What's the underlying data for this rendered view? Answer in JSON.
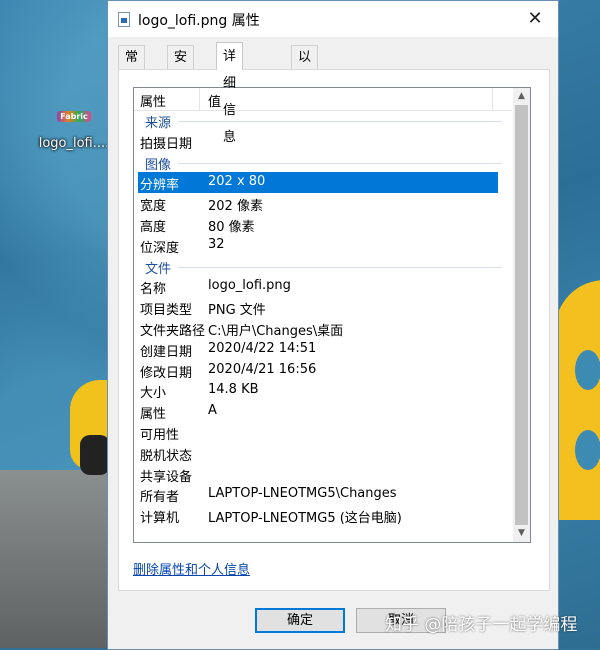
{
  "desktop": {
    "icon_label": "logo_lofi....",
    "icon_thumb_text": "Fabric"
  },
  "dialog": {
    "title": "logo_lofi.png 属性",
    "close_glyph": "✕",
    "tabs": [
      {
        "label": "常规",
        "active": false
      },
      {
        "label": "安全",
        "active": false
      },
      {
        "label": "详细信息",
        "active": true
      },
      {
        "label": "以前的版本",
        "active": false
      }
    ],
    "details": {
      "header": {
        "property": "属性",
        "value": "值"
      },
      "rows": [
        {
          "type": "group",
          "key": "来源"
        },
        {
          "type": "item",
          "key": "拍摄日期",
          "value": ""
        },
        {
          "type": "group",
          "key": "图像"
        },
        {
          "type": "item",
          "key": "分辨率",
          "value": "202 x 80",
          "selected": true
        },
        {
          "type": "item",
          "key": "宽度",
          "value": "202 像素"
        },
        {
          "type": "item",
          "key": "高度",
          "value": "80 像素"
        },
        {
          "type": "item",
          "key": "位深度",
          "value": "32"
        },
        {
          "type": "group",
          "key": "文件"
        },
        {
          "type": "item",
          "key": "名称",
          "value": "logo_lofi.png"
        },
        {
          "type": "item",
          "key": "项目类型",
          "value": "PNG 文件"
        },
        {
          "type": "item",
          "key": "文件夹路径",
          "value": "C:\\用户\\Changes\\桌面"
        },
        {
          "type": "item",
          "key": "创建日期",
          "value": "2020/4/22 14:51"
        },
        {
          "type": "item",
          "key": "修改日期",
          "value": "2020/4/21 16:56"
        },
        {
          "type": "item",
          "key": "大小",
          "value": "14.8 KB"
        },
        {
          "type": "item",
          "key": "属性",
          "value": "A"
        },
        {
          "type": "item",
          "key": "可用性",
          "value": ""
        },
        {
          "type": "item",
          "key": "脱机状态",
          "value": ""
        },
        {
          "type": "item",
          "key": "共享设备",
          "value": ""
        },
        {
          "type": "item",
          "key": "所有者",
          "value": "LAPTOP-LNEOTMG5\\Changes"
        },
        {
          "type": "item",
          "key": "计算机",
          "value": "LAPTOP-LNEOTMG5 (这台电脑)"
        }
      ]
    },
    "remove_link": "删除属性和个人信息",
    "ok_button": "确定",
    "cancel_button": "取消"
  },
  "watermark": "知乎 @陪孩子一起学编程",
  "colors": {
    "selection": "#0078d7",
    "group_header": "#1c4f9c",
    "link": "#0645ad"
  }
}
